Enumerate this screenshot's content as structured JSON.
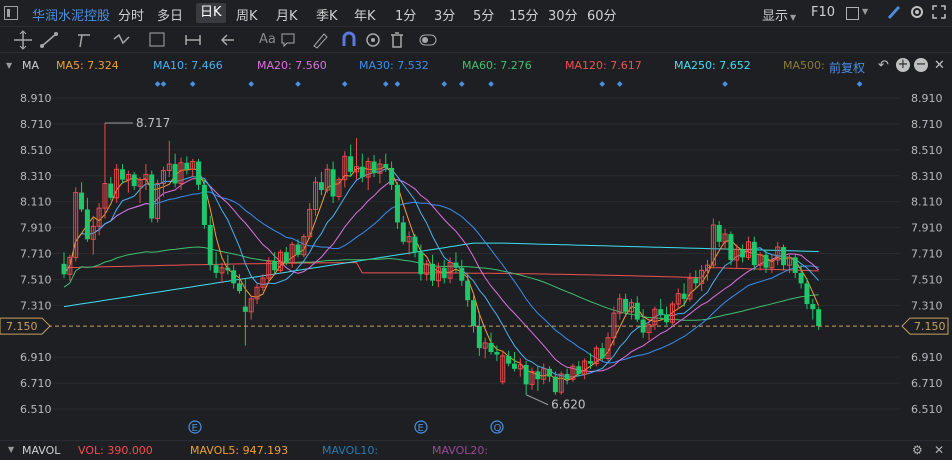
{
  "stock_name": "华润水泥控股",
  "periods": [
    "分时",
    "多日",
    "日K",
    "周K",
    "月K",
    "季K",
    "年K",
    "1分",
    "3分",
    "5分",
    "15分",
    "30分",
    "60分"
  ],
  "active_period": "日K",
  "right_controls": {
    "display": "显示",
    "f10": "F10"
  },
  "toolbar_icons": [
    "crosshair-icon",
    "line-tool-icon",
    "channel-tool-icon",
    "wave-tool-icon",
    "measure-tool-icon",
    "interval-tool-icon",
    "arrow-tool-icon",
    "text-tool-icon",
    "note-tool-icon",
    "pen-icon",
    "magnet-icon",
    "eye-icon",
    "trash-icon",
    "toggle-icon"
  ],
  "toolbar_text_label": "Aa",
  "ma_bar": {
    "label": "MA",
    "items": [
      {
        "label": "MA5: 7.324",
        "color": "#f0a030"
      },
      {
        "label": "MA10: 7.466",
        "color": "#4ab0f0"
      },
      {
        "label": "MA20: 7.560",
        "color": "#e070e0"
      },
      {
        "label": "MA30: 7.532",
        "color": "#3a8ef0"
      },
      {
        "label": "MA60: 7.276",
        "color": "#40c070"
      },
      {
        "label": "MA120: 7.617",
        "color": "#f05050"
      },
      {
        "label": "MA250: 7.652",
        "color": "#40e0f0"
      },
      {
        "label": "MA500:",
        "color": "#8a7a40"
      }
    ],
    "adjust": "前复权"
  },
  "y_axis": {
    "min": 6.51,
    "max": 8.91,
    "ticks": [
      "8.910",
      "8.710",
      "8.510",
      "8.310",
      "8.110",
      "7.910",
      "7.710",
      "7.510",
      "7.310",
      "7.150",
      "6.910",
      "6.710",
      "6.510"
    ]
  },
  "current_price": "7.150",
  "annotations": {
    "high": "8.717",
    "low": "6.620"
  },
  "event_markers": [
    "E",
    "E",
    "Q"
  ],
  "volume_bar": {
    "label": "MAVOL",
    "vol": "VOL: 390.000",
    "mavol5": "MAVOL5: 947.193",
    "mavol10": "MAVOL10:",
    "mavol20": "MAVOL20:"
  },
  "colors": {
    "up": "#e84b4b",
    "down": "#1fc66a",
    "bg": "#1e1f23",
    "accent": "#4a90e2"
  },
  "chart_data": {
    "type": "candlestick",
    "series_ohlc": [
      [
        7.63,
        7.72,
        7.52,
        7.55
      ],
      [
        7.55,
        7.7,
        7.5,
        7.68
      ],
      [
        7.68,
        8.22,
        7.65,
        8.18
      ],
      [
        8.18,
        8.26,
        8.03,
        8.05
      ],
      [
        8.05,
        8.14,
        7.8,
        7.82
      ],
      [
        7.82,
        8.0,
        7.7,
        7.92
      ],
      [
        7.92,
        8.1,
        7.85,
        8.06
      ],
      [
        8.06,
        8.717,
        7.98,
        8.25
      ],
      [
        8.25,
        8.3,
        8.12,
        8.14
      ],
      [
        8.14,
        8.4,
        8.1,
        8.36
      ],
      [
        8.36,
        8.4,
        8.25,
        8.28
      ],
      [
        8.28,
        8.35,
        8.18,
        8.32
      ],
      [
        8.32,
        8.34,
        8.2,
        8.23
      ],
      [
        8.23,
        8.3,
        8.1,
        8.28
      ],
      [
        8.28,
        8.4,
        8.2,
        8.32
      ],
      [
        8.32,
        8.35,
        7.95,
        7.98
      ],
      [
        7.98,
        8.28,
        7.95,
        8.25
      ],
      [
        8.25,
        8.38,
        8.15,
        8.35
      ],
      [
        8.35,
        8.58,
        8.3,
        8.4
      ],
      [
        8.4,
        8.48,
        8.22,
        8.25
      ],
      [
        8.25,
        8.45,
        8.2,
        8.41
      ],
      [
        8.41,
        8.46,
        8.32,
        8.36
      ],
      [
        8.36,
        8.44,
        8.3,
        8.42
      ],
      [
        8.42,
        8.44,
        8.2,
        8.24
      ],
      [
        8.24,
        8.28,
        7.9,
        7.93
      ],
      [
        7.93,
        8.0,
        7.58,
        7.62
      ],
      [
        7.62,
        7.72,
        7.52,
        7.56
      ],
      [
        7.56,
        7.64,
        7.48,
        7.6
      ],
      [
        7.6,
        7.7,
        7.55,
        7.58
      ],
      [
        7.58,
        7.62,
        7.44,
        7.48
      ],
      [
        7.48,
        7.55,
        7.4,
        7.42
      ],
      [
        7.3,
        7.52,
        7.0,
        7.26
      ],
      [
        7.26,
        7.38,
        7.2,
        7.36
      ],
      [
        7.36,
        7.48,
        7.32,
        7.45
      ],
      [
        7.45,
        7.55,
        7.42,
        7.52
      ],
      [
        7.52,
        7.68,
        7.48,
        7.65
      ],
      [
        7.65,
        7.72,
        7.56,
        7.58
      ],
      [
        7.58,
        7.74,
        7.56,
        7.72
      ],
      [
        7.72,
        7.76,
        7.62,
        7.64
      ],
      [
        7.64,
        7.8,
        7.6,
        7.78
      ],
      [
        7.78,
        7.82,
        7.68,
        7.7
      ],
      [
        7.7,
        7.86,
        7.68,
        7.84
      ],
      [
        7.84,
        8.1,
        7.82,
        8.05
      ],
      [
        8.05,
        8.3,
        8.0,
        8.26
      ],
      [
        8.26,
        8.34,
        8.16,
        8.2
      ],
      [
        8.2,
        8.4,
        8.18,
        8.36
      ],
      [
        8.36,
        8.42,
        8.1,
        8.15
      ],
      [
        8.15,
        8.3,
        8.12,
        8.28
      ],
      [
        8.28,
        8.5,
        8.22,
        8.46
      ],
      [
        8.46,
        8.55,
        8.3,
        8.34
      ],
      [
        8.34,
        8.6,
        8.28,
        8.38
      ],
      [
        8.38,
        8.48,
        8.26,
        8.3
      ],
      [
        8.3,
        8.45,
        8.2,
        8.42
      ],
      [
        8.42,
        8.47,
        8.3,
        8.33
      ],
      [
        8.33,
        8.44,
        8.25,
        8.4
      ],
      [
        8.4,
        8.48,
        8.34,
        8.37
      ],
      [
        8.37,
        8.42,
        8.2,
        8.24
      ],
      [
        8.24,
        8.26,
        7.9,
        7.95
      ],
      [
        7.95,
        8.0,
        7.78,
        7.8
      ],
      [
        7.8,
        7.88,
        7.7,
        7.84
      ],
      [
        7.84,
        7.86,
        7.68,
        7.72
      ],
      [
        7.72,
        7.78,
        7.5,
        7.55
      ],
      [
        7.55,
        7.66,
        7.5,
        7.63
      ],
      [
        7.63,
        7.7,
        7.46,
        7.5
      ],
      [
        7.5,
        7.64,
        7.45,
        7.6
      ],
      [
        7.6,
        7.66,
        7.48,
        7.52
      ],
      [
        7.52,
        7.68,
        7.48,
        7.64
      ],
      [
        7.64,
        7.72,
        7.56,
        7.6
      ],
      [
        7.6,
        7.66,
        7.46,
        7.5
      ],
      [
        7.5,
        7.56,
        7.3,
        7.35
      ],
      [
        7.35,
        7.4,
        7.1,
        7.15
      ],
      [
        7.15,
        7.26,
        6.92,
        6.98
      ],
      [
        6.98,
        7.06,
        6.9,
        7.02
      ],
      [
        7.02,
        7.1,
        6.93,
        6.95
      ],
      [
        6.95,
        7.0,
        6.88,
        6.93
      ],
      [
        6.72,
        6.96,
        6.7,
        6.92
      ],
      [
        6.92,
        6.96,
        6.84,
        6.86
      ],
      [
        6.86,
        6.95,
        6.8,
        6.82
      ],
      [
        6.82,
        6.9,
        6.76,
        6.85
      ],
      [
        6.85,
        6.88,
        6.62,
        6.7
      ],
      [
        6.7,
        6.83,
        6.66,
        6.8
      ],
      [
        6.8,
        6.84,
        6.65,
        6.74
      ],
      [
        6.74,
        6.86,
        6.7,
        6.82
      ],
      [
        6.82,
        6.84,
        6.72,
        6.76
      ],
      [
        6.76,
        6.8,
        6.62,
        6.64
      ],
      [
        6.64,
        6.8,
        6.62,
        6.78
      ],
      [
        6.78,
        6.82,
        6.7,
        6.74
      ],
      [
        6.74,
        6.86,
        6.72,
        6.84
      ],
      [
        6.84,
        6.88,
        6.76,
        6.78
      ],
      [
        6.78,
        6.9,
        6.74,
        6.88
      ],
      [
        6.88,
        6.94,
        6.82,
        6.86
      ],
      [
        6.86,
        7.0,
        6.84,
        6.98
      ],
      [
        6.98,
        7.02,
        6.88,
        6.9
      ],
      [
        6.9,
        7.1,
        6.88,
        7.06
      ],
      [
        7.06,
        7.3,
        7.0,
        7.25
      ],
      [
        7.25,
        7.4,
        7.2,
        7.36
      ],
      [
        7.36,
        7.4,
        7.22,
        7.26
      ],
      [
        7.26,
        7.36,
        7.2,
        7.33
      ],
      [
        7.33,
        7.38,
        7.18,
        7.2
      ],
      [
        7.2,
        7.28,
        7.06,
        7.1
      ],
      [
        7.1,
        7.2,
        7.04,
        7.16
      ],
      [
        7.16,
        7.3,
        7.12,
        7.28
      ],
      [
        7.28,
        7.36,
        7.2,
        7.24
      ],
      [
        7.24,
        7.3,
        7.16,
        7.18
      ],
      [
        7.18,
        7.34,
        7.16,
        7.32
      ],
      [
        7.32,
        7.44,
        7.28,
        7.4
      ],
      [
        7.4,
        7.48,
        7.3,
        7.36
      ],
      [
        7.36,
        7.56,
        7.34,
        7.52
      ],
      [
        7.52,
        7.58,
        7.44,
        7.48
      ],
      [
        7.48,
        7.62,
        7.42,
        7.58
      ],
      [
        7.58,
        7.66,
        7.5,
        7.62
      ],
      [
        7.62,
        7.98,
        7.6,
        7.93
      ],
      [
        7.93,
        7.96,
        7.76,
        7.8
      ],
      [
        7.8,
        7.9,
        7.74,
        7.86
      ],
      [
        7.86,
        7.88,
        7.62,
        7.66
      ],
      [
        7.66,
        7.78,
        7.6,
        7.74
      ],
      [
        7.74,
        7.78,
        7.64,
        7.68
      ],
      [
        7.68,
        7.84,
        7.66,
        7.8
      ],
      [
        7.8,
        7.84,
        7.58,
        7.62
      ],
      [
        7.62,
        7.72,
        7.58,
        7.7
      ],
      [
        7.7,
        7.74,
        7.56,
        7.6
      ],
      [
        7.6,
        7.7,
        7.56,
        7.66
      ],
      [
        7.66,
        7.8,
        7.62,
        7.76
      ],
      [
        7.76,
        7.78,
        7.58,
        7.62
      ],
      [
        7.62,
        7.7,
        7.56,
        7.68
      ],
      [
        7.68,
        7.7,
        7.52,
        7.56
      ],
      [
        7.56,
        7.62,
        7.44,
        7.48
      ],
      [
        7.48,
        7.52,
        7.28,
        7.32
      ],
      [
        7.32,
        7.36,
        7.2,
        7.28
      ],
      [
        7.28,
        7.3,
        7.12,
        7.15
      ]
    ]
  }
}
